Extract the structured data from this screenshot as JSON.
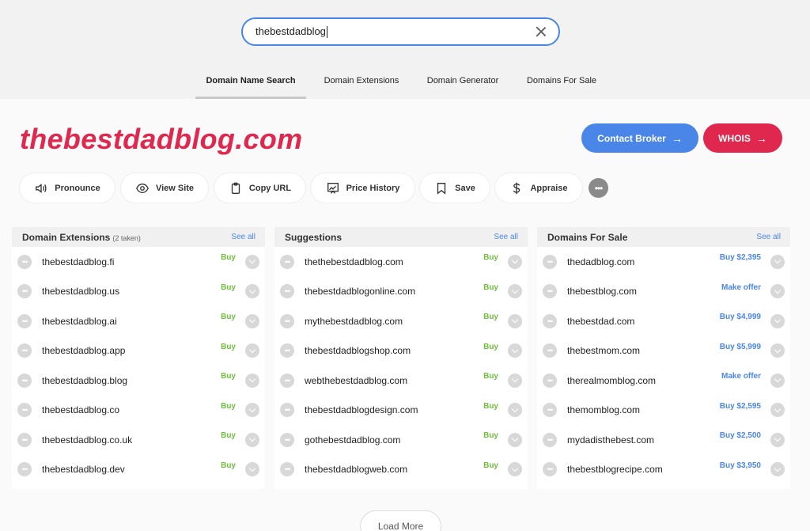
{
  "search": {
    "value": "thebestdadblog"
  },
  "tabs": [
    {
      "label": "Domain Name Search"
    },
    {
      "label": "Domain Extensions"
    },
    {
      "label": "Domain Generator"
    },
    {
      "label": "Domains For Sale"
    }
  ],
  "domain": {
    "title": "thebestdadblog.com"
  },
  "buttons": {
    "contact_broker": "Contact Broker",
    "whois": "WHOIS"
  },
  "actions": [
    {
      "label": "Pronounce",
      "icon": "speaker-icon"
    },
    {
      "label": "View Site",
      "icon": "eye-icon"
    },
    {
      "label": "Copy URL",
      "icon": "clipboard-icon"
    },
    {
      "label": "Price History",
      "icon": "chart-icon"
    },
    {
      "label": "Save",
      "icon": "bookmark-icon"
    },
    {
      "label": "Appraise",
      "icon": "dollar-icon"
    }
  ],
  "columns": {
    "extensions": {
      "title": "Domain Extensions",
      "subtitle": "(2 taken)",
      "see_all": "See all",
      "rows": [
        {
          "name": "thebestdadblog.fi",
          "action": "Buy"
        },
        {
          "name": "thebestdadblog.us",
          "action": "Buy"
        },
        {
          "name": "thebestdadblog.ai",
          "action": "Buy"
        },
        {
          "name": "thebestdadblog.app",
          "action": "Buy"
        },
        {
          "name": "thebestdadblog.blog",
          "action": "Buy"
        },
        {
          "name": "thebestdadblog.co",
          "action": "Buy"
        },
        {
          "name": "thebestdadblog.co.uk",
          "action": "Buy"
        },
        {
          "name": "thebestdadblog.dev",
          "action": "Buy"
        }
      ]
    },
    "suggestions": {
      "title": "Suggestions",
      "see_all": "See all",
      "rows": [
        {
          "name": "thethebestdadblog.com",
          "action": "Buy"
        },
        {
          "name": "thebestdadblogonline.com",
          "action": "Buy"
        },
        {
          "name": "mythebestdadblog.com",
          "action": "Buy"
        },
        {
          "name": "thebestdadblogshop.com",
          "action": "Buy"
        },
        {
          "name": "webthebestdadblog.com",
          "action": "Buy"
        },
        {
          "name": "thebestdadblogdesign.com",
          "action": "Buy"
        },
        {
          "name": "gothebestdadblog.com",
          "action": "Buy"
        },
        {
          "name": "thebestdadblogweb.com",
          "action": "Buy"
        }
      ]
    },
    "for_sale": {
      "title": "Domains For Sale",
      "see_all": "See all",
      "rows": [
        {
          "name": "thedadblog.com",
          "action": "Buy $2,395"
        },
        {
          "name": "thebestblog.com",
          "action": "Make offer"
        },
        {
          "name": "thebestdad.com",
          "action": "Buy $4,999"
        },
        {
          "name": "thebestmom.com",
          "action": "Buy $5,999"
        },
        {
          "name": "therealmomblog.com",
          "action": "Make offer"
        },
        {
          "name": "themomblog.com",
          "action": "Buy $2,595"
        },
        {
          "name": "mydadisthebest.com",
          "action": "Buy $2,500"
        },
        {
          "name": "thebestblogrecipe.com",
          "action": "Buy $3,950"
        }
      ]
    }
  },
  "load_more": "Load More",
  "colors": {
    "accent_blue": "#4a86e8",
    "brand_red": "#e0284f",
    "buy_green": "#6fbf3d"
  }
}
